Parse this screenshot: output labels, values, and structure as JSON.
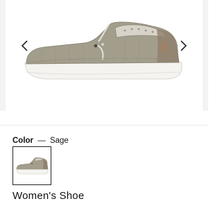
{
  "gallery": {
    "image_alt": "Women's Shoe in Sage",
    "prev_icon": "chevron-left-icon",
    "next_icon": "chevron-right-icon"
  },
  "color": {
    "label": "Color",
    "separator": "—",
    "selected": "Sage",
    "swatch_colors": {
      "upper": "#a39d8c",
      "heel": "#8e7f6a",
      "sole": "#f4f3f0"
    }
  },
  "product": {
    "title": "Women's Shoe"
  }
}
